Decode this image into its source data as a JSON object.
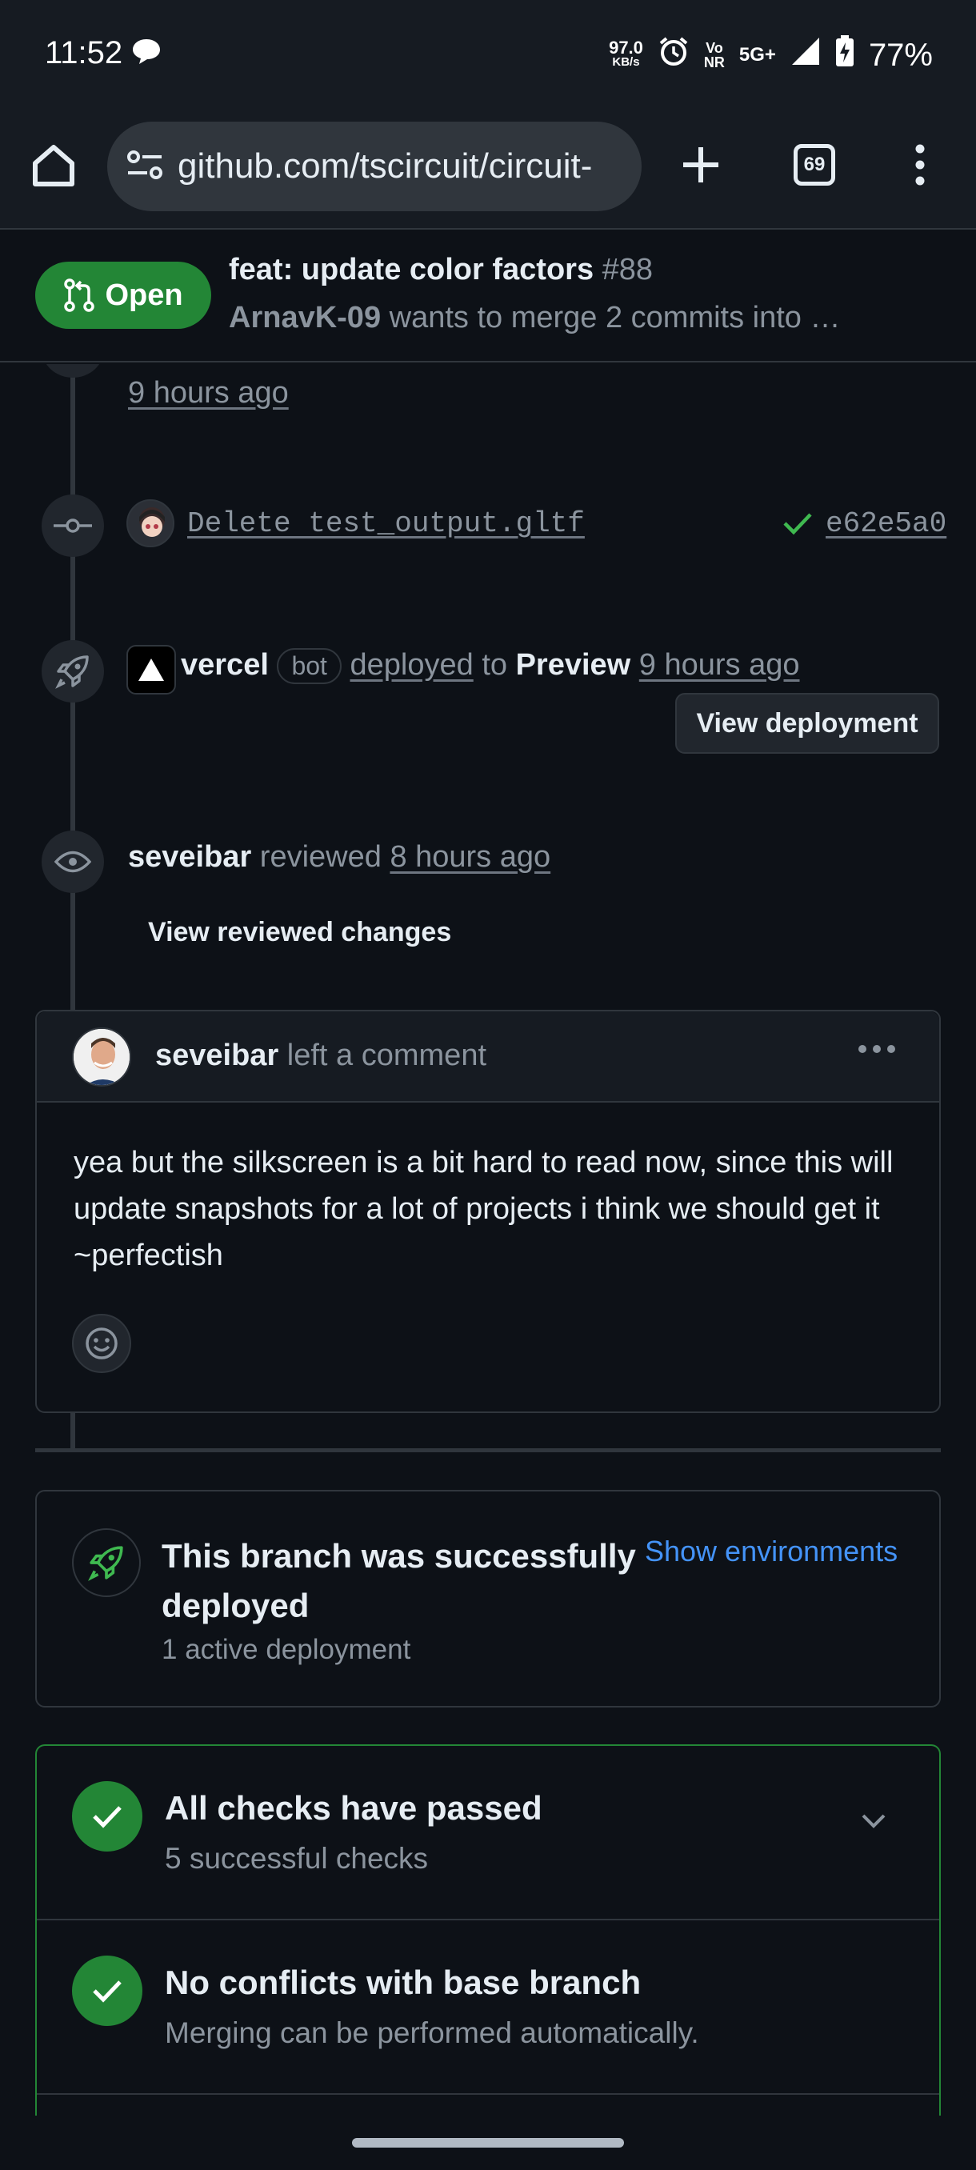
{
  "status_bar": {
    "time": "11:52",
    "net_speed_value": "97.0",
    "net_speed_unit": "KB/s",
    "volte_top": "Vo",
    "volte_bottom": "NR",
    "network": "5G+",
    "battery": "77%"
  },
  "browser": {
    "url": "github.com/tscircuit/circuit-",
    "tab_count": "69"
  },
  "pr_header": {
    "state": "Open",
    "title": "feat: update color factors",
    "number": "#88",
    "author": "ArnavK-09",
    "subtitle": "wants to merge 2 commits into …"
  },
  "timeline": {
    "prev_time": "9 hours ago",
    "commit": {
      "message": "Delete test_output.gltf",
      "sha": "e62e5a0"
    },
    "deploy": {
      "actor": "vercel",
      "badge": "bot",
      "action": "deployed",
      "to": "to",
      "env": "Preview",
      "time": "9 hours ago",
      "button": "View deployment"
    },
    "review": {
      "actor": "seveibar",
      "action": "reviewed",
      "time": "8 hours ago",
      "link": "View reviewed changes"
    }
  },
  "comment": {
    "author": "seveibar",
    "action": "left a comment",
    "body": "yea but the silkscreen is a bit hard to read now, since this will update snapshots for a lot of projects i think we should get it ~perfectish"
  },
  "deployment_box": {
    "title": "This branch was successfully deployed",
    "link": "Show environments",
    "count": "1 active deployment"
  },
  "merge_box": {
    "checks_title": "All checks have passed",
    "checks_sub": "5 successful checks",
    "conflicts_title": "No conflicts with base branch",
    "conflicts_sub": "Merging can be performed automatically."
  },
  "colors": {
    "background": "#0d1117",
    "success": "#238636",
    "link_blue": "#4493f8"
  }
}
